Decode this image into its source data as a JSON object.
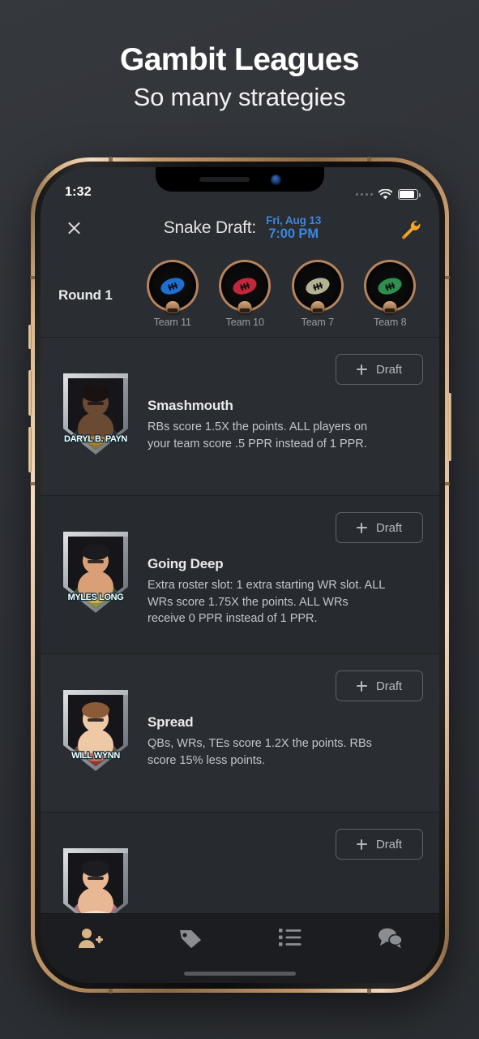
{
  "promo": {
    "title": "Gambit Leagues",
    "subtitle": "So many strategies"
  },
  "statusbar": {
    "time": "1:32",
    "wifi_icon": "wifi-icon",
    "battery_icon": "battery-icon",
    "signal_icon": "signal-dots-icon"
  },
  "navbar": {
    "close_icon": "close-icon",
    "title": "Snake Draft:",
    "date": "Fri, Aug 13",
    "time": "7:00 PM",
    "settings_icon": "wrench-icon",
    "accent_blue": "#3b87e0",
    "accent_orange": "#f5a623"
  },
  "round": {
    "label": "Round 1",
    "teams": [
      {
        "name": "Team 11",
        "ball_color": "#1f6fd0"
      },
      {
        "name": "Team 10",
        "ball_color": "#c0283a"
      },
      {
        "name": "Team 7",
        "ball_color": "#b3b294"
      },
      {
        "name": "Team 8",
        "ball_color": "#2f8f4e"
      }
    ]
  },
  "strategies": [
    {
      "title": "Smashmouth",
      "description": "RBs score 1.5X the points. ALL players on your team score .5 PPR instead of 1 PPR.",
      "character_name": "DARYL B. PAYN",
      "draft_label": "Draft",
      "skin": "#6b4a33",
      "shirt": "#2b2b30",
      "hair": "#1a1210",
      "accent": "#e0b33a"
    },
    {
      "title": "Going Deep",
      "description": "Extra roster slot: 1 extra starting WR slot. ALL WRs score 1.75X the points. ALL WRs receive 0 PPR instead of 1 PPR.",
      "character_name": "MYLES LONG",
      "draft_label": "Draft",
      "skin": "#d9a078",
      "shirt": "#3f5230",
      "hair": "#1b1b1f",
      "accent": "#cfc63f"
    },
    {
      "title": "Spread",
      "description": "QBs, WRs, TEs score 1.2X the points. RBs score 15% less points.",
      "character_name": "WILL WYNN",
      "draft_label": "Draft",
      "skin": "#efc9a6",
      "shirt": "#6b4d38",
      "hair": "#8b5a36",
      "accent": "#9c2b2b"
    },
    {
      "title": "",
      "description": "",
      "character_name": "",
      "draft_label": "Draft",
      "skin": "#e8b793",
      "shirt": "#b8707a",
      "hair": "#1d1d21",
      "accent": "#ffffff"
    }
  ],
  "tabbar": {
    "items": [
      {
        "icon": "person-add-icon",
        "active": true,
        "color": "#d9b489"
      },
      {
        "icon": "tag-icon",
        "active": false,
        "color": "#8a8d92"
      },
      {
        "icon": "list-icon",
        "active": false,
        "color": "#8a8d92"
      },
      {
        "icon": "chat-icon",
        "active": false,
        "color": "#8a8d92"
      }
    ]
  }
}
